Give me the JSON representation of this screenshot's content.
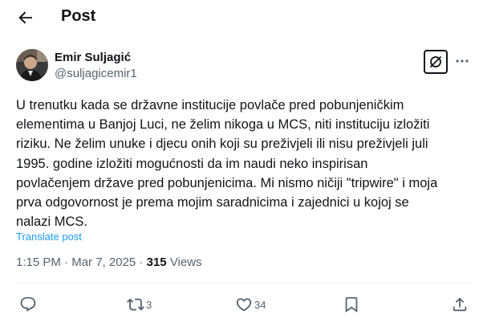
{
  "header": {
    "title": "Post"
  },
  "author": {
    "name": "Emir Suljagić",
    "handle": "@suljagicemir1"
  },
  "tweet": {
    "lines": [
      "U trenutku kada se državne institucije povlače pred pobunjeničkim",
      "elementima u Banjoj Luci, ne želim nikoga u MCS, niti instituciju izložiti",
      "riziku. Ne želim unuke i djecu onih koji su preživjeli ili nisu preživjeli juli",
      "1995. godine izložiti mogućnosti da im naudi neko inspirisan",
      "povlačenjem države pred pobunjenicima. Mi nismo ničiji \"tripwire\" i moja",
      "prva odgovornost je prema mojim saradnicima i zajednici u kojoj se",
      "nalazi MCS."
    ],
    "translate_label": "Translate post",
    "time": "1:15 PM",
    "separator": "·",
    "date": "Mar 7, 2025",
    "views_count": "315",
    "views_label": "Views"
  },
  "actions": {
    "reply_count": "",
    "repost_count": "3",
    "like_count": "34"
  },
  "icons": {
    "back": "arrow-left-icon",
    "grok": "grok-icon",
    "more": "more-horizontal-icon",
    "reply": "reply-icon",
    "repost": "repost-icon",
    "like": "heart-icon",
    "bookmark": "bookmark-icon",
    "share": "share-icon"
  },
  "colors": {
    "text": "#0f1419",
    "secondary": "#536471",
    "link": "#1d9bf0",
    "divider": "#eff3f4"
  }
}
